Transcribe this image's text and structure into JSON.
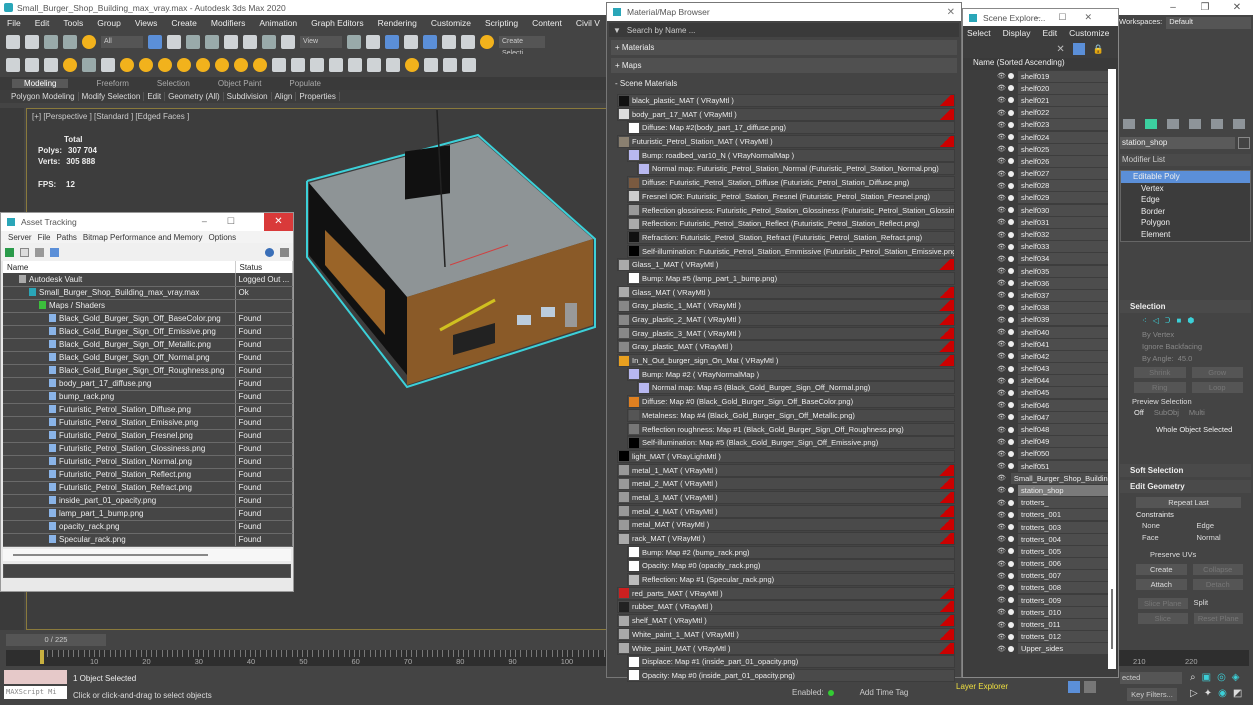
{
  "app": {
    "title": "Small_Burger_Shop_Building_max_vray.max - Autodesk 3ds Max 2020",
    "window_controls": [
      "–",
      "❐",
      "✕"
    ]
  },
  "menubar": [
    "File",
    "Edit",
    "Tools",
    "Group",
    "Views",
    "Create",
    "Modifiers",
    "Animation",
    "Graph Editors",
    "Rendering",
    "Customize",
    "Scripting",
    "Content",
    "Civil V"
  ],
  "toolbar": {
    "selection_filter": "All",
    "ref_coord": "View",
    "create_selection_set": "Create Selecti"
  },
  "ribbon": {
    "tabs": [
      "Modeling",
      "Freeform",
      "Selection",
      "Object Paint",
      "Populate"
    ],
    "active_tab": "Modeling",
    "sub": [
      "Polygon Modeling",
      "Modify Selection",
      "Edit",
      "Geometry (All)",
      "Subdivision",
      "Align",
      "Properties"
    ]
  },
  "viewport": {
    "label": "[+] [Perspective ] [Standard ] [Edged Faces ]",
    "stats": {
      "header": "Total",
      "polys_label": "Polys:",
      "polys": "307 704",
      "verts_label": "Verts:",
      "verts": "305 888",
      "fps_label": "FPS:",
      "fps": "12"
    }
  },
  "asset_tracking": {
    "title": "Asset Tracking",
    "menus": [
      "Server",
      "File",
      "Paths",
      "Bitmap Performance and Memory",
      "Options"
    ],
    "columns": [
      "Name",
      "Status"
    ],
    "rows": [
      {
        "name": "Autodesk Vault",
        "status": "Logged Out ...",
        "level": 1,
        "icon": "vault-icon"
      },
      {
        "name": "Small_Burger_Shop_Building_max_vray.max",
        "status": "Ok",
        "level": 2,
        "icon": "max-file-icon"
      },
      {
        "name": "Maps / Shaders",
        "status": "",
        "level": 3,
        "icon": "maps-icon"
      },
      {
        "name": "Black_Gold_Burger_Sign_Off_BaseColor.png",
        "status": "Found",
        "level": 4,
        "icon": "image-file-icon"
      },
      {
        "name": "Black_Gold_Burger_Sign_Off_Emissive.png",
        "status": "Found",
        "level": 4,
        "icon": "image-file-icon"
      },
      {
        "name": "Black_Gold_Burger_Sign_Off_Metallic.png",
        "status": "Found",
        "level": 4,
        "icon": "image-file-icon"
      },
      {
        "name": "Black_Gold_Burger_Sign_Off_Normal.png",
        "status": "Found",
        "level": 4,
        "icon": "image-file-icon"
      },
      {
        "name": "Black_Gold_Burger_Sign_Off_Roughness.png",
        "status": "Found",
        "level": 4,
        "icon": "image-file-icon"
      },
      {
        "name": "body_part_17_diffuse.png",
        "status": "Found",
        "level": 4,
        "icon": "image-file-icon"
      },
      {
        "name": "bump_rack.png",
        "status": "Found",
        "level": 4,
        "icon": "image-file-icon"
      },
      {
        "name": "Futuristic_Petrol_Station_Diffuse.png",
        "status": "Found",
        "level": 4,
        "icon": "image-file-icon"
      },
      {
        "name": "Futuristic_Petrol_Station_Emissive.png",
        "status": "Found",
        "level": 4,
        "icon": "image-file-icon"
      },
      {
        "name": "Futuristic_Petrol_Station_Fresnel.png",
        "status": "Found",
        "level": 4,
        "icon": "image-file-icon"
      },
      {
        "name": "Futuristic_Petrol_Station_Glossiness.png",
        "status": "Found",
        "level": 4,
        "icon": "image-file-icon"
      },
      {
        "name": "Futuristic_Petrol_Station_Normal.png",
        "status": "Found",
        "level": 4,
        "icon": "image-file-icon"
      },
      {
        "name": "Futuristic_Petrol_Station_Reflect.png",
        "status": "Found",
        "level": 4,
        "icon": "image-file-icon"
      },
      {
        "name": "Futuristic_Petrol_Station_Refract.png",
        "status": "Found",
        "level": 4,
        "icon": "image-file-icon"
      },
      {
        "name": "inside_part_01_opacity.png",
        "status": "Found",
        "level": 4,
        "icon": "image-file-icon"
      },
      {
        "name": "lamp_part_1_bump.png",
        "status": "Found",
        "level": 4,
        "icon": "image-file-icon"
      },
      {
        "name": "opacity_rack.png",
        "status": "Found",
        "level": 4,
        "icon": "image-file-icon"
      },
      {
        "name": "Specular_rack.png",
        "status": "Found",
        "level": 4,
        "icon": "image-file-icon"
      }
    ]
  },
  "timeline": {
    "slider": "0 / 225",
    "ticks": [
      "10",
      "20",
      "30",
      "40",
      "50",
      "60",
      "70",
      "80",
      "90",
      "100"
    ],
    "ticks_right": [
      "210",
      "220"
    ]
  },
  "status": {
    "selected": "1 Object Selected",
    "hint": "Click or click-and-drag to select objects",
    "maxscript": "MAXScript Mi"
  },
  "material_browser": {
    "title": "Material/Map Browser",
    "search_placeholder": "Search by Name ...",
    "sections": [
      "+ Materials",
      "+ Maps",
      "- Scene Materials"
    ],
    "items": [
      {
        "label": "black_plastic_MAT  ( VRayMtl )",
        "level": 0,
        "swatch": "#111111",
        "flag": true
      },
      {
        "label": "body_part_17_MAT  ( VRayMtl )",
        "level": 0,
        "swatch": "#dddddd",
        "flag": true
      },
      {
        "label": "Diffuse: Map #2(body_part_17_diffuse.png)",
        "level": 1,
        "swatch": "#ffffff",
        "flag": false
      },
      {
        "label": "Futuristic_Petrol_Station_MAT  ( VRayMtl )",
        "level": 0,
        "swatch": "#8a8070",
        "flag": true
      },
      {
        "label": "Bump: roadbed_var10_N  ( VRayNormalMap )",
        "level": 1,
        "swatch": "#b8b8f0",
        "flag": false
      },
      {
        "label": "Normal map: Futuristic_Petrol_Station_Normal (Futuristic_Petrol_Station_Normal.png)",
        "level": 2,
        "swatch": "#b8b8f0",
        "flag": false
      },
      {
        "label": "Diffuse: Futuristic_Petrol_Station_Diffuse (Futuristic_Petrol_Station_Diffuse.png)",
        "level": 1,
        "swatch": "#7a5a40",
        "flag": false
      },
      {
        "label": "Fresnel IOR: Futuristic_Petrol_Station_Fresnel (Futuristic_Petrol_Station_Fresnel.png)",
        "level": 1,
        "swatch": "#cccccc",
        "flag": false
      },
      {
        "label": "Reflection glossiness: Futuristic_Petrol_Station_Glossiness (Futuristic_Petrol_Station_Glossin...",
        "level": 1,
        "swatch": "#999999",
        "flag": false
      },
      {
        "label": "Reflection: Futuristic_Petrol_Station_Reflect (Futuristic_Petrol_Station_Reflect.png)",
        "level": 1,
        "swatch": "#aaaaaa",
        "flag": false
      },
      {
        "label": "Refraction: Futuristic_Petrol_Station_Refract (Futuristic_Petrol_Station_Refract.png)",
        "level": 1,
        "swatch": "#111111",
        "flag": false
      },
      {
        "label": "Self-illumination: Futuristic_Petrol_Station_Emmissive (Futuristic_Petrol_Station_Emissive.png)",
        "level": 1,
        "swatch": "#000000",
        "flag": false
      },
      {
        "label": "Glass_1_MAT  ( VRayMtl )",
        "level": 0,
        "swatch": "#aaaaaa",
        "flag": true
      },
      {
        "label": "Bump: Map #5 (lamp_part_1_bump.png)",
        "level": 1,
        "swatch": "#ffffff",
        "flag": false
      },
      {
        "label": "Glass_MAT  ( VRayMtl )",
        "level": 0,
        "swatch": "#aaaaaa",
        "flag": true
      },
      {
        "label": "Gray_plastic_1_MAT  ( VRayMtl )",
        "level": 0,
        "swatch": "#888888",
        "flag": true
      },
      {
        "label": "Gray_plastic_2_MAT  ( VRayMtl )",
        "level": 0,
        "swatch": "#888888",
        "flag": true
      },
      {
        "label": "Gray_plastic_3_MAT  ( VRayMtl )",
        "level": 0,
        "swatch": "#888888",
        "flag": true
      },
      {
        "label": "Gray_plastic_MAT  ( VRayMtl )",
        "level": 0,
        "swatch": "#888888",
        "flag": true
      },
      {
        "label": "In_N_Out_burger_sign_On_Mat  ( VRayMtl )",
        "level": 0,
        "swatch": "#e8a020",
        "flag": true
      },
      {
        "label": "Bump: Map #2  ( VRayNormalMap )",
        "level": 1,
        "swatch": "#b8b8f0",
        "flag": false
      },
      {
        "label": "Normal map: Map #3 (Black_Gold_Burger_Sign_Off_Normal.png)",
        "level": 2,
        "swatch": "#b8b8f0",
        "flag": false
      },
      {
        "label": "Diffuse: Map #0 (Black_Gold_Burger_Sign_Off_BaseColor.png)",
        "level": 1,
        "swatch": "#e08020",
        "flag": false
      },
      {
        "label": "Metalness: Map #4 (Black_Gold_Burger_Sign_Off_Metallic.png)",
        "level": 1,
        "swatch": "#555555",
        "flag": false
      },
      {
        "label": "Reflection roughness: Map #1 (Black_Gold_Burger_Sign_Off_Roughness.png)",
        "level": 1,
        "swatch": "#777777",
        "flag": false
      },
      {
        "label": "Self-illumination: Map #5 (Black_Gold_Burger_Sign_Off_Emissive.png)",
        "level": 1,
        "swatch": "#000000",
        "flag": false
      },
      {
        "label": "light_MAT  ( VRayLightMtl )",
        "level": 0,
        "swatch": "#000000",
        "flag": false
      },
      {
        "label": "metal_1_MAT  ( VRayMtl )",
        "level": 0,
        "swatch": "#999999",
        "flag": true
      },
      {
        "label": "metal_2_MAT  ( VRayMtl )",
        "level": 0,
        "swatch": "#999999",
        "flag": true
      },
      {
        "label": "metal_3_MAT  ( VRayMtl )",
        "level": 0,
        "swatch": "#999999",
        "flag": true
      },
      {
        "label": "metal_4_MAT  ( VRayMtl )",
        "level": 0,
        "swatch": "#999999",
        "flag": true
      },
      {
        "label": "metal_MAT  ( VRayMtl )",
        "level": 0,
        "swatch": "#999999",
        "flag": true
      },
      {
        "label": "rack_MAT  ( VRayMtl )",
        "level": 0,
        "swatch": "#aaaaaa",
        "flag": true
      },
      {
        "label": "Bump: Map #2 (bump_rack.png)",
        "level": 1,
        "swatch": "#ffffff",
        "flag": false
      },
      {
        "label": "Opacity: Map #0 (opacity_rack.png)",
        "level": 1,
        "swatch": "#ffffff",
        "flag": false
      },
      {
        "label": "Reflection: Map #1 (Specular_rack.png)",
        "level": 1,
        "swatch": "#bbbbbb",
        "flag": false
      },
      {
        "label": "red_parts_MAT  ( VRayMtl )",
        "level": 0,
        "swatch": "#cc2020",
        "flag": true
      },
      {
        "label": "rubber_MAT  ( VRayMtl )",
        "level": 0,
        "swatch": "#222222",
        "flag": true
      },
      {
        "label": "shelf_MAT  ( VRayMtl )",
        "level": 0,
        "swatch": "#aaaaaa",
        "flag": true
      },
      {
        "label": "White_paint_1_MAT  ( VRayMtl )",
        "level": 0,
        "swatch": "#aaaaaa",
        "flag": true
      },
      {
        "label": "White_paint_MAT  ( VRayMtl )",
        "level": 0,
        "swatch": "#aaaaaa",
        "flag": true
      },
      {
        "label": "Displace: Map #1 (inside_part_01_opacity.png)",
        "level": 1,
        "swatch": "#ffffff",
        "flag": false
      },
      {
        "label": "Opacity: Map #0 (inside_part_01_opacity.png)",
        "level": 1,
        "swatch": "#ffffff",
        "flag": false
      }
    ]
  },
  "scene_explorer": {
    "title": "Scene Explore...",
    "menus": [
      "Select",
      "Display",
      "Edit",
      "Customize"
    ],
    "column_header": "Name (Sorted Ascending)",
    "items": [
      "shelf019",
      "shelf020",
      "shelf021",
      "shelf022",
      "shelf023",
      "shelf024",
      "shelf025",
      "shelf026",
      "shelf027",
      "shelf028",
      "shelf029",
      "shelf030",
      "shelf031",
      "shelf032",
      "shelf033",
      "shelf034",
      "shelf035",
      "shelf036",
      "shelf037",
      "shelf038",
      "shelf039",
      "shelf040",
      "shelf041",
      "shelf042",
      "shelf043",
      "shelf044",
      "shelf045",
      "shelf046",
      "shelf047",
      "shelf048",
      "shelf049",
      "shelf050",
      "shelf051",
      "Small_Burger_Shop_Building",
      "station_shop",
      "trotters_",
      "trotters_001",
      "trotters_003",
      "trotters_004",
      "trotters_005",
      "trotters_006",
      "trotters_007",
      "trotters_008",
      "trotters_009",
      "trotters_010",
      "trotters_011",
      "trotters_012",
      "Upper_sides"
    ],
    "selected": "station_shop",
    "footer": "Layer Explorer"
  },
  "command_panel": {
    "workspaces_label": "Workspaces:",
    "workspace": "Default",
    "object_name": "station_shop",
    "modifier_list": "Modifier List",
    "stack": [
      "Editable Poly",
      "Vertex",
      "Edge",
      "Border",
      "Polygon",
      "Element"
    ],
    "selection": {
      "title": "Selection",
      "by_vertex": "By Vertex",
      "ignore_backfacing": "Ignore Backfacing",
      "by_angle": "By Angle:",
      "angle": "45.0",
      "shrink": "Shrink",
      "grow": "Grow",
      "ring": "Ring",
      "loop": "Loop",
      "preview_selection": "Preview Selection",
      "preview_options": [
        "Off",
        "SubObj",
        "Multi"
      ],
      "preview_value": "Off",
      "status": "Whole Object Selected"
    },
    "soft_selection": "Soft Selection",
    "edit_geometry": {
      "title": "Edit Geometry",
      "repeat_last": "Repeat Last",
      "constraints": "Constraints",
      "constraint_options": [
        "None",
        "Edge",
        "Face",
        "Normal"
      ],
      "constraint_value": "None",
      "preserve_uvs": "Preserve UVs",
      "create": "Create",
      "collapse": "Collapse",
      "attach": "Attach",
      "detach": "Detach",
      "slice_plane": "Slice Plane",
      "split": "Split",
      "slice": "Slice",
      "reset_plane": "Reset Plane"
    }
  },
  "bottom": {
    "enabled_label": "Enabled:",
    "add_time_tag": "Add Time Tag",
    "selected_dd": "ected",
    "key_filters": "Key Filters..."
  }
}
